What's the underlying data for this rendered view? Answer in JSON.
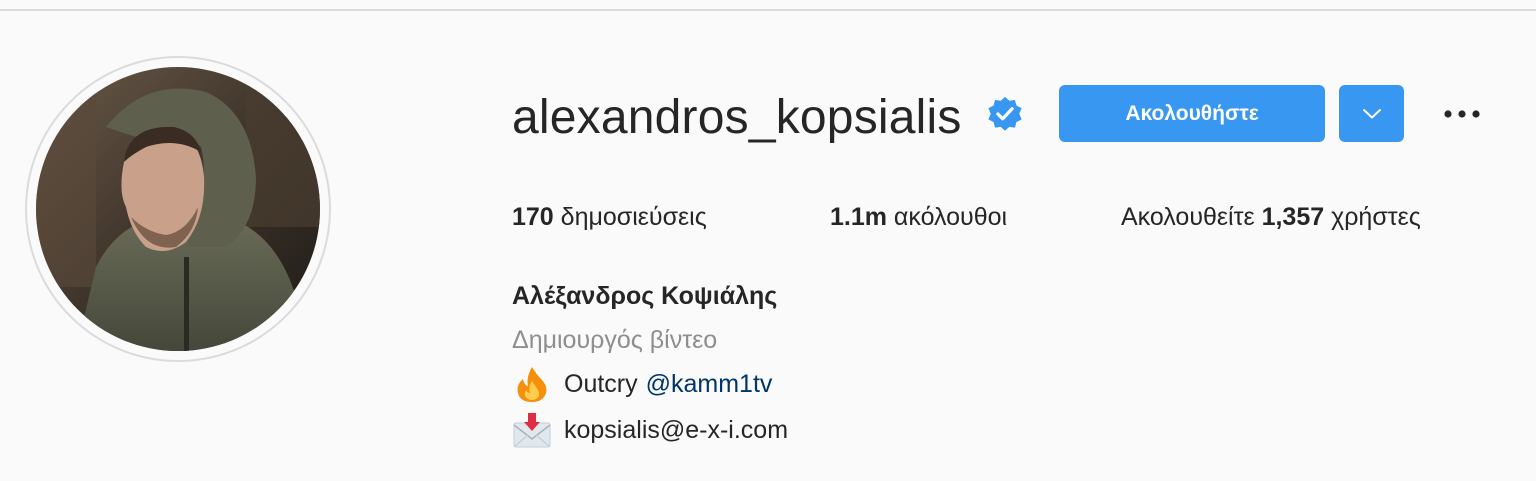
{
  "profile": {
    "username": "alexandros_kopsialis",
    "verified_icon": "verified-badge-icon",
    "follow_label": "Ακολουθήστε",
    "dropdown_icon": "chevron-down-icon",
    "more_icon": "more-horizontal-icon",
    "avatar_icon": "profile-avatar"
  },
  "stats": {
    "posts_count": "170",
    "posts_label": " δημοσιεύσεις",
    "followers_count": "1.1m",
    "followers_label": " ακόλουθοι",
    "following_prefix": "Ακολουθείτε ",
    "following_count": "1,357",
    "following_suffix": " χρήστες"
  },
  "bio": {
    "full_name": "Αλέξανδρος Κοψιάλης",
    "category": "Δημιουργός βίντεο",
    "line1_icon": "fire-emoji-icon",
    "line1_text": "Outcry",
    "line1_mention": "@kamm1tv",
    "line2_icon": "envelope-emoji-icon",
    "line2_text": "kopsialis@e-x-i.com"
  },
  "colors": {
    "accent": "#3897f0",
    "background": "#fafafa",
    "text": "#262626",
    "secondary_text": "#8e8e8e",
    "mention": "#003569"
  }
}
